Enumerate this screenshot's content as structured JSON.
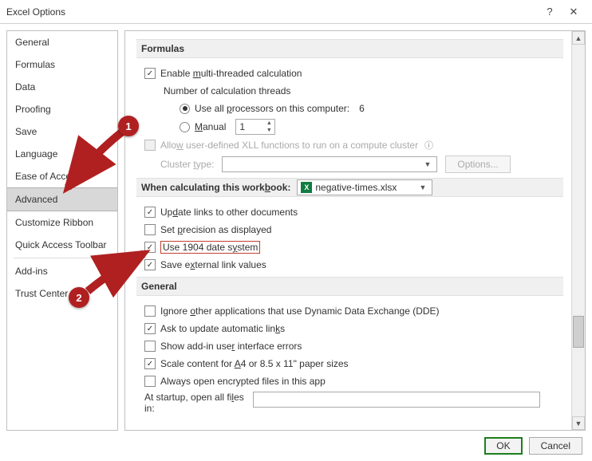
{
  "title": "Excel Options",
  "sidebar": {
    "items": [
      {
        "label": "General"
      },
      {
        "label": "Formulas"
      },
      {
        "label": "Data"
      },
      {
        "label": "Proofing"
      },
      {
        "label": "Save"
      },
      {
        "label": "Language"
      },
      {
        "label": "Ease of Access"
      },
      {
        "label": "Advanced",
        "selected": true
      },
      {
        "label": "Customize Ribbon"
      },
      {
        "label": "Quick Access Toolbar"
      },
      {
        "label": "Add-ins"
      },
      {
        "label": "Trust Center"
      }
    ]
  },
  "formulas": {
    "heading": "Formulas",
    "multithread": "Enable multi-threaded calculation",
    "threads_label": "Number of calculation threads",
    "use_all_label": "Use all processors on this computer:",
    "processor_count": "6",
    "manual_label": "Manual",
    "manual_value": "1",
    "xll_label": "Allow user-defined XLL functions to run on a compute cluster",
    "cluster_label": "Cluster type:",
    "cluster_value": "",
    "options_btn": "Options..."
  },
  "calc": {
    "heading": "When calculating this workbook:",
    "workbook": "negative-times.xlsx",
    "update_links": "Update links to other documents",
    "precision": "Set precision as displayed",
    "use_1904": "Use 1904 date system",
    "external_links": "Save external link values"
  },
  "general": {
    "heading": "General",
    "ignore_dde": "Ignore other applications that use Dynamic Data Exchange (DDE)",
    "update_auto_links": "Ask to update automatic links",
    "addin_errors": "Show add-in user interface errors",
    "scale_a4": "Scale content for A4 or 8.5 x 11\" paper sizes",
    "open_encrypted": "Always open encrypted files in this app",
    "startup_label": "At startup, open all files in:",
    "startup_value": ""
  },
  "buttons": {
    "ok": "OK",
    "cancel": "Cancel"
  },
  "annotations": {
    "a1": "1",
    "a2": "2"
  }
}
